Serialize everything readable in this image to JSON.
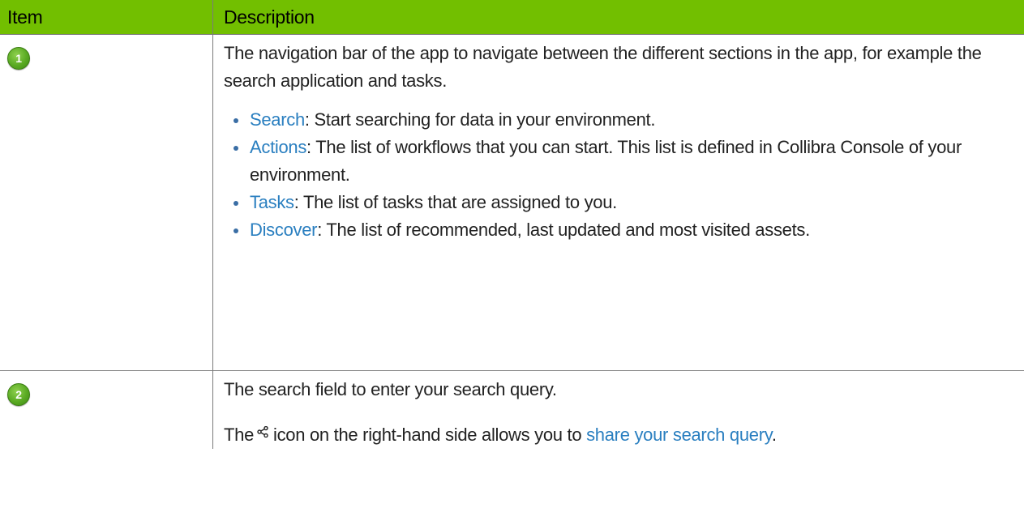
{
  "table": {
    "headers": {
      "item": "Item",
      "description": "Description"
    },
    "rows": [
      {
        "badge": "1",
        "intro": "The navigation bar of the app to navigate between the different sections in the app, for example the search application and tasks.",
        "bullets": [
          {
            "link": "Search",
            "text": ": Start searching for data in your environment."
          },
          {
            "link": "Actions",
            "text": ": The list of workflows that you can start. This list is defined in Collibra Console of your environment."
          },
          {
            "link": "Tasks",
            "text": ": The list of tasks that are assigned to you."
          },
          {
            "link": "Discover",
            "text": ": The list of recommended, last updated and most visited assets."
          }
        ]
      },
      {
        "badge": "2",
        "intro": "The search field to enter your search query.",
        "share_line": {
          "before": "The",
          "icon": "share-icon",
          "after": "icon on the right-hand side allows you to ",
          "link": "share your search query",
          "end": "."
        }
      }
    ]
  },
  "colors": {
    "header_bg": "#72bf00",
    "link": "#2a7fc0",
    "badge": "#5aaa23"
  }
}
